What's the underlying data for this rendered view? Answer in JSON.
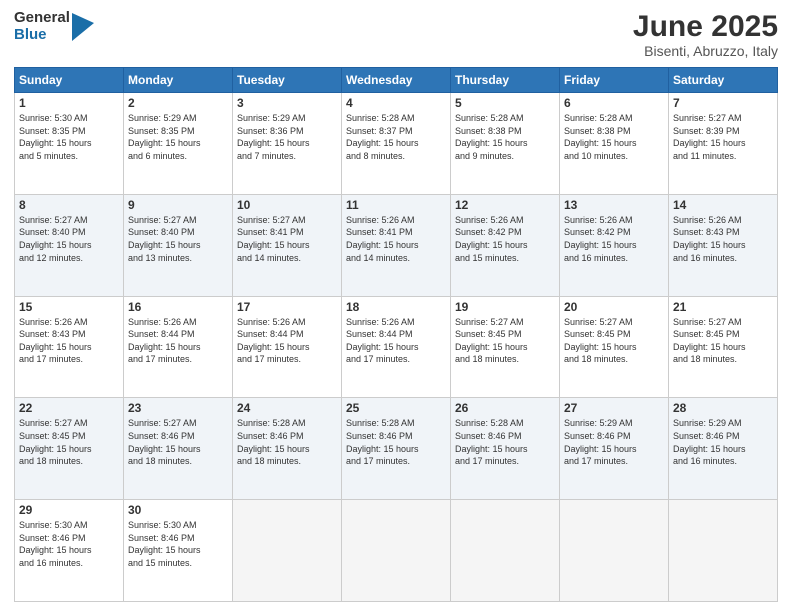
{
  "logo": {
    "general": "General",
    "blue": "Blue"
  },
  "title": "June 2025",
  "location": "Bisenti, Abruzzo, Italy",
  "days_of_week": [
    "Sunday",
    "Monday",
    "Tuesday",
    "Wednesday",
    "Thursday",
    "Friday",
    "Saturday"
  ],
  "weeks": [
    [
      {
        "day": "1",
        "info": "Sunrise: 5:30 AM\nSunset: 8:35 PM\nDaylight: 15 hours\nand 5 minutes."
      },
      {
        "day": "2",
        "info": "Sunrise: 5:29 AM\nSunset: 8:35 PM\nDaylight: 15 hours\nand 6 minutes."
      },
      {
        "day": "3",
        "info": "Sunrise: 5:29 AM\nSunset: 8:36 PM\nDaylight: 15 hours\nand 7 minutes."
      },
      {
        "day": "4",
        "info": "Sunrise: 5:28 AM\nSunset: 8:37 PM\nDaylight: 15 hours\nand 8 minutes."
      },
      {
        "day": "5",
        "info": "Sunrise: 5:28 AM\nSunset: 8:38 PM\nDaylight: 15 hours\nand 9 minutes."
      },
      {
        "day": "6",
        "info": "Sunrise: 5:28 AM\nSunset: 8:38 PM\nDaylight: 15 hours\nand 10 minutes."
      },
      {
        "day": "7",
        "info": "Sunrise: 5:27 AM\nSunset: 8:39 PM\nDaylight: 15 hours\nand 11 minutes."
      }
    ],
    [
      {
        "day": "8",
        "info": "Sunrise: 5:27 AM\nSunset: 8:40 PM\nDaylight: 15 hours\nand 12 minutes."
      },
      {
        "day": "9",
        "info": "Sunrise: 5:27 AM\nSunset: 8:40 PM\nDaylight: 15 hours\nand 13 minutes."
      },
      {
        "day": "10",
        "info": "Sunrise: 5:27 AM\nSunset: 8:41 PM\nDaylight: 15 hours\nand 14 minutes."
      },
      {
        "day": "11",
        "info": "Sunrise: 5:26 AM\nSunset: 8:41 PM\nDaylight: 15 hours\nand 14 minutes."
      },
      {
        "day": "12",
        "info": "Sunrise: 5:26 AM\nSunset: 8:42 PM\nDaylight: 15 hours\nand 15 minutes."
      },
      {
        "day": "13",
        "info": "Sunrise: 5:26 AM\nSunset: 8:42 PM\nDaylight: 15 hours\nand 16 minutes."
      },
      {
        "day": "14",
        "info": "Sunrise: 5:26 AM\nSunset: 8:43 PM\nDaylight: 15 hours\nand 16 minutes."
      }
    ],
    [
      {
        "day": "15",
        "info": "Sunrise: 5:26 AM\nSunset: 8:43 PM\nDaylight: 15 hours\nand 17 minutes."
      },
      {
        "day": "16",
        "info": "Sunrise: 5:26 AM\nSunset: 8:44 PM\nDaylight: 15 hours\nand 17 minutes."
      },
      {
        "day": "17",
        "info": "Sunrise: 5:26 AM\nSunset: 8:44 PM\nDaylight: 15 hours\nand 17 minutes."
      },
      {
        "day": "18",
        "info": "Sunrise: 5:26 AM\nSunset: 8:44 PM\nDaylight: 15 hours\nand 17 minutes."
      },
      {
        "day": "19",
        "info": "Sunrise: 5:27 AM\nSunset: 8:45 PM\nDaylight: 15 hours\nand 18 minutes."
      },
      {
        "day": "20",
        "info": "Sunrise: 5:27 AM\nSunset: 8:45 PM\nDaylight: 15 hours\nand 18 minutes."
      },
      {
        "day": "21",
        "info": "Sunrise: 5:27 AM\nSunset: 8:45 PM\nDaylight: 15 hours\nand 18 minutes."
      }
    ],
    [
      {
        "day": "22",
        "info": "Sunrise: 5:27 AM\nSunset: 8:45 PM\nDaylight: 15 hours\nand 18 minutes."
      },
      {
        "day": "23",
        "info": "Sunrise: 5:27 AM\nSunset: 8:46 PM\nDaylight: 15 hours\nand 18 minutes."
      },
      {
        "day": "24",
        "info": "Sunrise: 5:28 AM\nSunset: 8:46 PM\nDaylight: 15 hours\nand 18 minutes."
      },
      {
        "day": "25",
        "info": "Sunrise: 5:28 AM\nSunset: 8:46 PM\nDaylight: 15 hours\nand 17 minutes."
      },
      {
        "day": "26",
        "info": "Sunrise: 5:28 AM\nSunset: 8:46 PM\nDaylight: 15 hours\nand 17 minutes."
      },
      {
        "day": "27",
        "info": "Sunrise: 5:29 AM\nSunset: 8:46 PM\nDaylight: 15 hours\nand 17 minutes."
      },
      {
        "day": "28",
        "info": "Sunrise: 5:29 AM\nSunset: 8:46 PM\nDaylight: 15 hours\nand 16 minutes."
      }
    ],
    [
      {
        "day": "29",
        "info": "Sunrise: 5:30 AM\nSunset: 8:46 PM\nDaylight: 15 hours\nand 16 minutes."
      },
      {
        "day": "30",
        "info": "Sunrise: 5:30 AM\nSunset: 8:46 PM\nDaylight: 15 hours\nand 15 minutes."
      },
      {
        "day": "",
        "info": ""
      },
      {
        "day": "",
        "info": ""
      },
      {
        "day": "",
        "info": ""
      },
      {
        "day": "",
        "info": ""
      },
      {
        "day": "",
        "info": ""
      }
    ]
  ]
}
